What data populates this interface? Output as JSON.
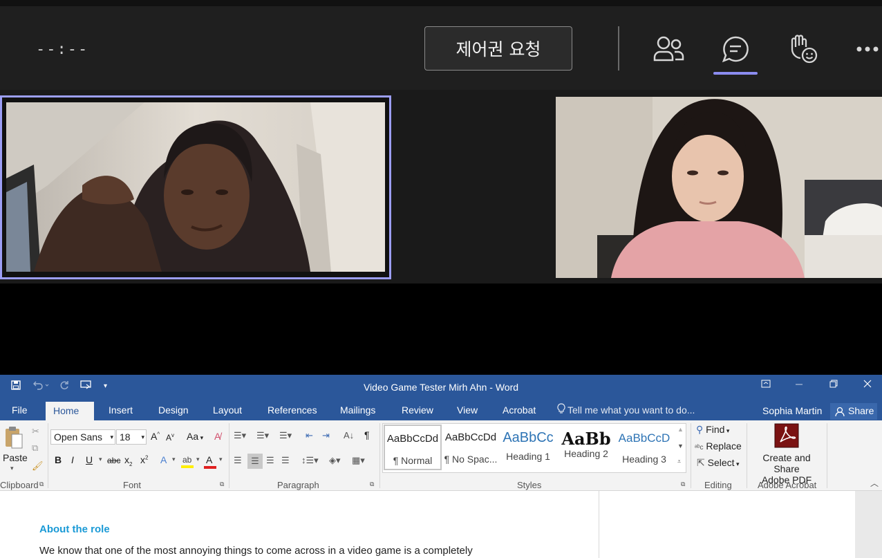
{
  "teams": {
    "timer": "--:--",
    "request_control_label": "제어권 요청",
    "icons": [
      "people-icon",
      "chat-icon",
      "raise-hand-icon",
      "more-icon"
    ],
    "accent_color": "#8b8cf0"
  },
  "word": {
    "title": "Video Game Tester Mirh Ahn - Word",
    "tabs": [
      {
        "label": "File"
      },
      {
        "label": "Home"
      },
      {
        "label": "Insert"
      },
      {
        "label": "Design"
      },
      {
        "label": "Layout"
      },
      {
        "label": "References"
      },
      {
        "label": "Mailings"
      },
      {
        "label": "Review"
      },
      {
        "label": "View"
      },
      {
        "label": "Acrobat"
      }
    ],
    "active_tab": "Home",
    "tell_me": "Tell me what you want to do...",
    "user": "Sophia Martin",
    "share_label": "Share",
    "brand_color": "#2b579a",
    "ribbon": {
      "clipboard": {
        "paste": "Paste",
        "label": "Clipboard"
      },
      "font": {
        "name": "Open Sans",
        "size": "18",
        "case": "Aa",
        "label": "Font"
      },
      "paragraph": {
        "label": "Paragraph"
      },
      "styles": {
        "label": "Styles",
        "items": [
          {
            "preview": "AaBbCcDd",
            "name": "¶ Normal"
          },
          {
            "preview": "AaBbCcDd",
            "name": "¶ No Spac..."
          },
          {
            "preview": "AaBbCc",
            "name": "Heading 1"
          },
          {
            "preview": "AaBb",
            "name": "Heading 2"
          },
          {
            "preview": "AaBbCcD",
            "name": "Heading 3"
          }
        ]
      },
      "editing": {
        "find": "Find",
        "replace": "Replace",
        "select": "Select",
        "label": "Editing"
      },
      "acrobat": {
        "line1": "Create and Share",
        "line2": "Adobe PDF",
        "label": "Adobe Acrobat"
      }
    },
    "document": {
      "heading": "About the role",
      "body": "We know that one of the most annoying things to come across in a video game is a completely"
    }
  }
}
